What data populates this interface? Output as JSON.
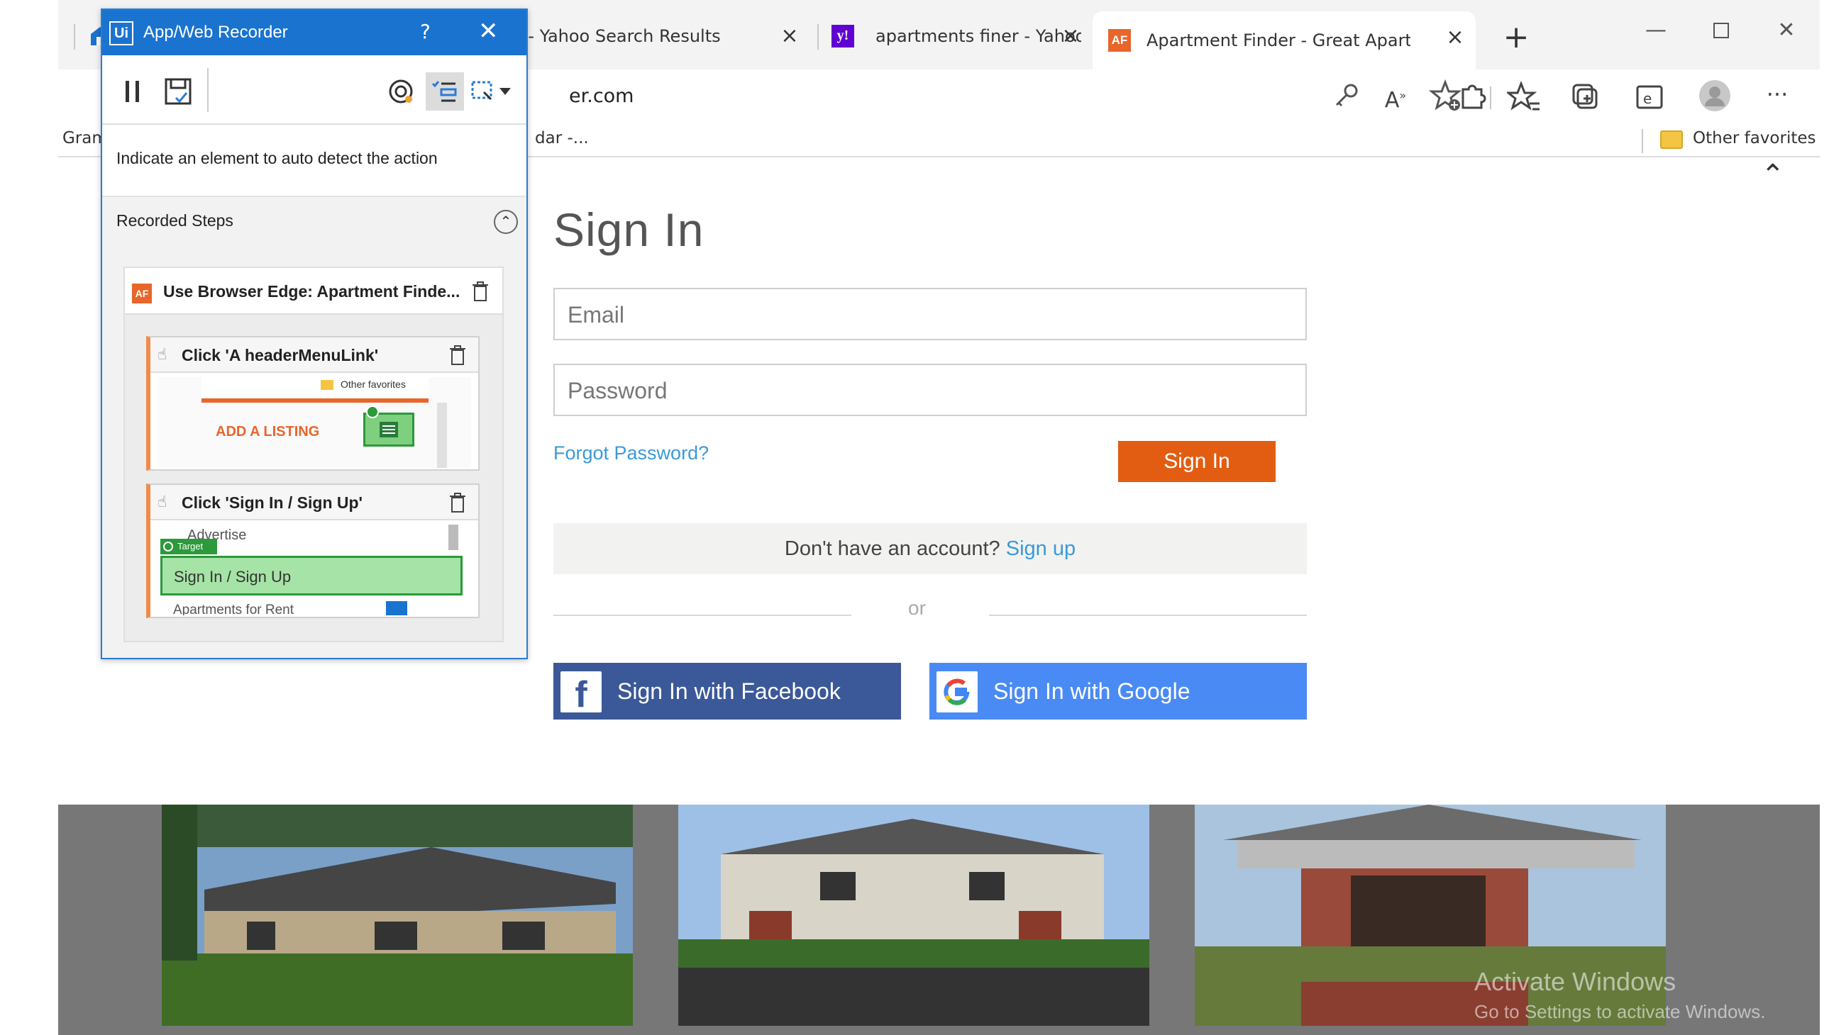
{
  "browser": {
    "tabs": [
      {
        "title": "o - Yahoo Search Results"
      },
      {
        "title": "apartments finer - Yahoo Search"
      },
      {
        "title": "Apartment Finder - Great Apartm",
        "favicon": "AF"
      }
    ],
    "yahoo_favicon": "y!",
    "url": "er.com",
    "favorites": {
      "left_item": "Gram",
      "middle_item": "dar -...",
      "other_favorites": "Other favorites"
    }
  },
  "page": {
    "title": "Sign In",
    "email_placeholder": "Email",
    "password_placeholder": "Password",
    "forgot_password": "Forgot Password?",
    "signin_button": "Sign In",
    "no_account_text": "Don't have an account?",
    "signup_link": "Sign up",
    "or": "or",
    "facebook_button": "Sign In with Facebook",
    "google_button": "Sign In with Google",
    "facebook_glyph": "f",
    "watermark": {
      "title": "Activate Windows",
      "subtitle": "Go to Settings to activate Windows."
    }
  },
  "recorder": {
    "logo": "Ui",
    "title": "App/Web Recorder",
    "help": "?",
    "instruction": "Indicate an element to auto detect the action",
    "recorded_steps_label": "Recorded Steps",
    "scope": {
      "favicon": "AF",
      "title": "Use Browser Edge: Apartment Finde..."
    },
    "steps": [
      {
        "title": "Click 'A headerMenuLink'",
        "thumb_fav": "Other favorites",
        "thumb_label": "ADD A LISTING"
      },
      {
        "title": "Click 'Sign In / Sign Up'",
        "thumb_top": "Advertise",
        "thumb_target_badge": "Target",
        "thumb_target": "Sign In / Sign Up",
        "thumb_bottom": "Apartments for Rent"
      }
    ]
  },
  "colors": {
    "recorder_blue": "#1b73d0",
    "signin_orange": "#e25d11",
    "link_blue": "#3a9ad9",
    "facebook": "#3b5998",
    "google": "#4a8af4",
    "af_orange": "#e8652b"
  }
}
